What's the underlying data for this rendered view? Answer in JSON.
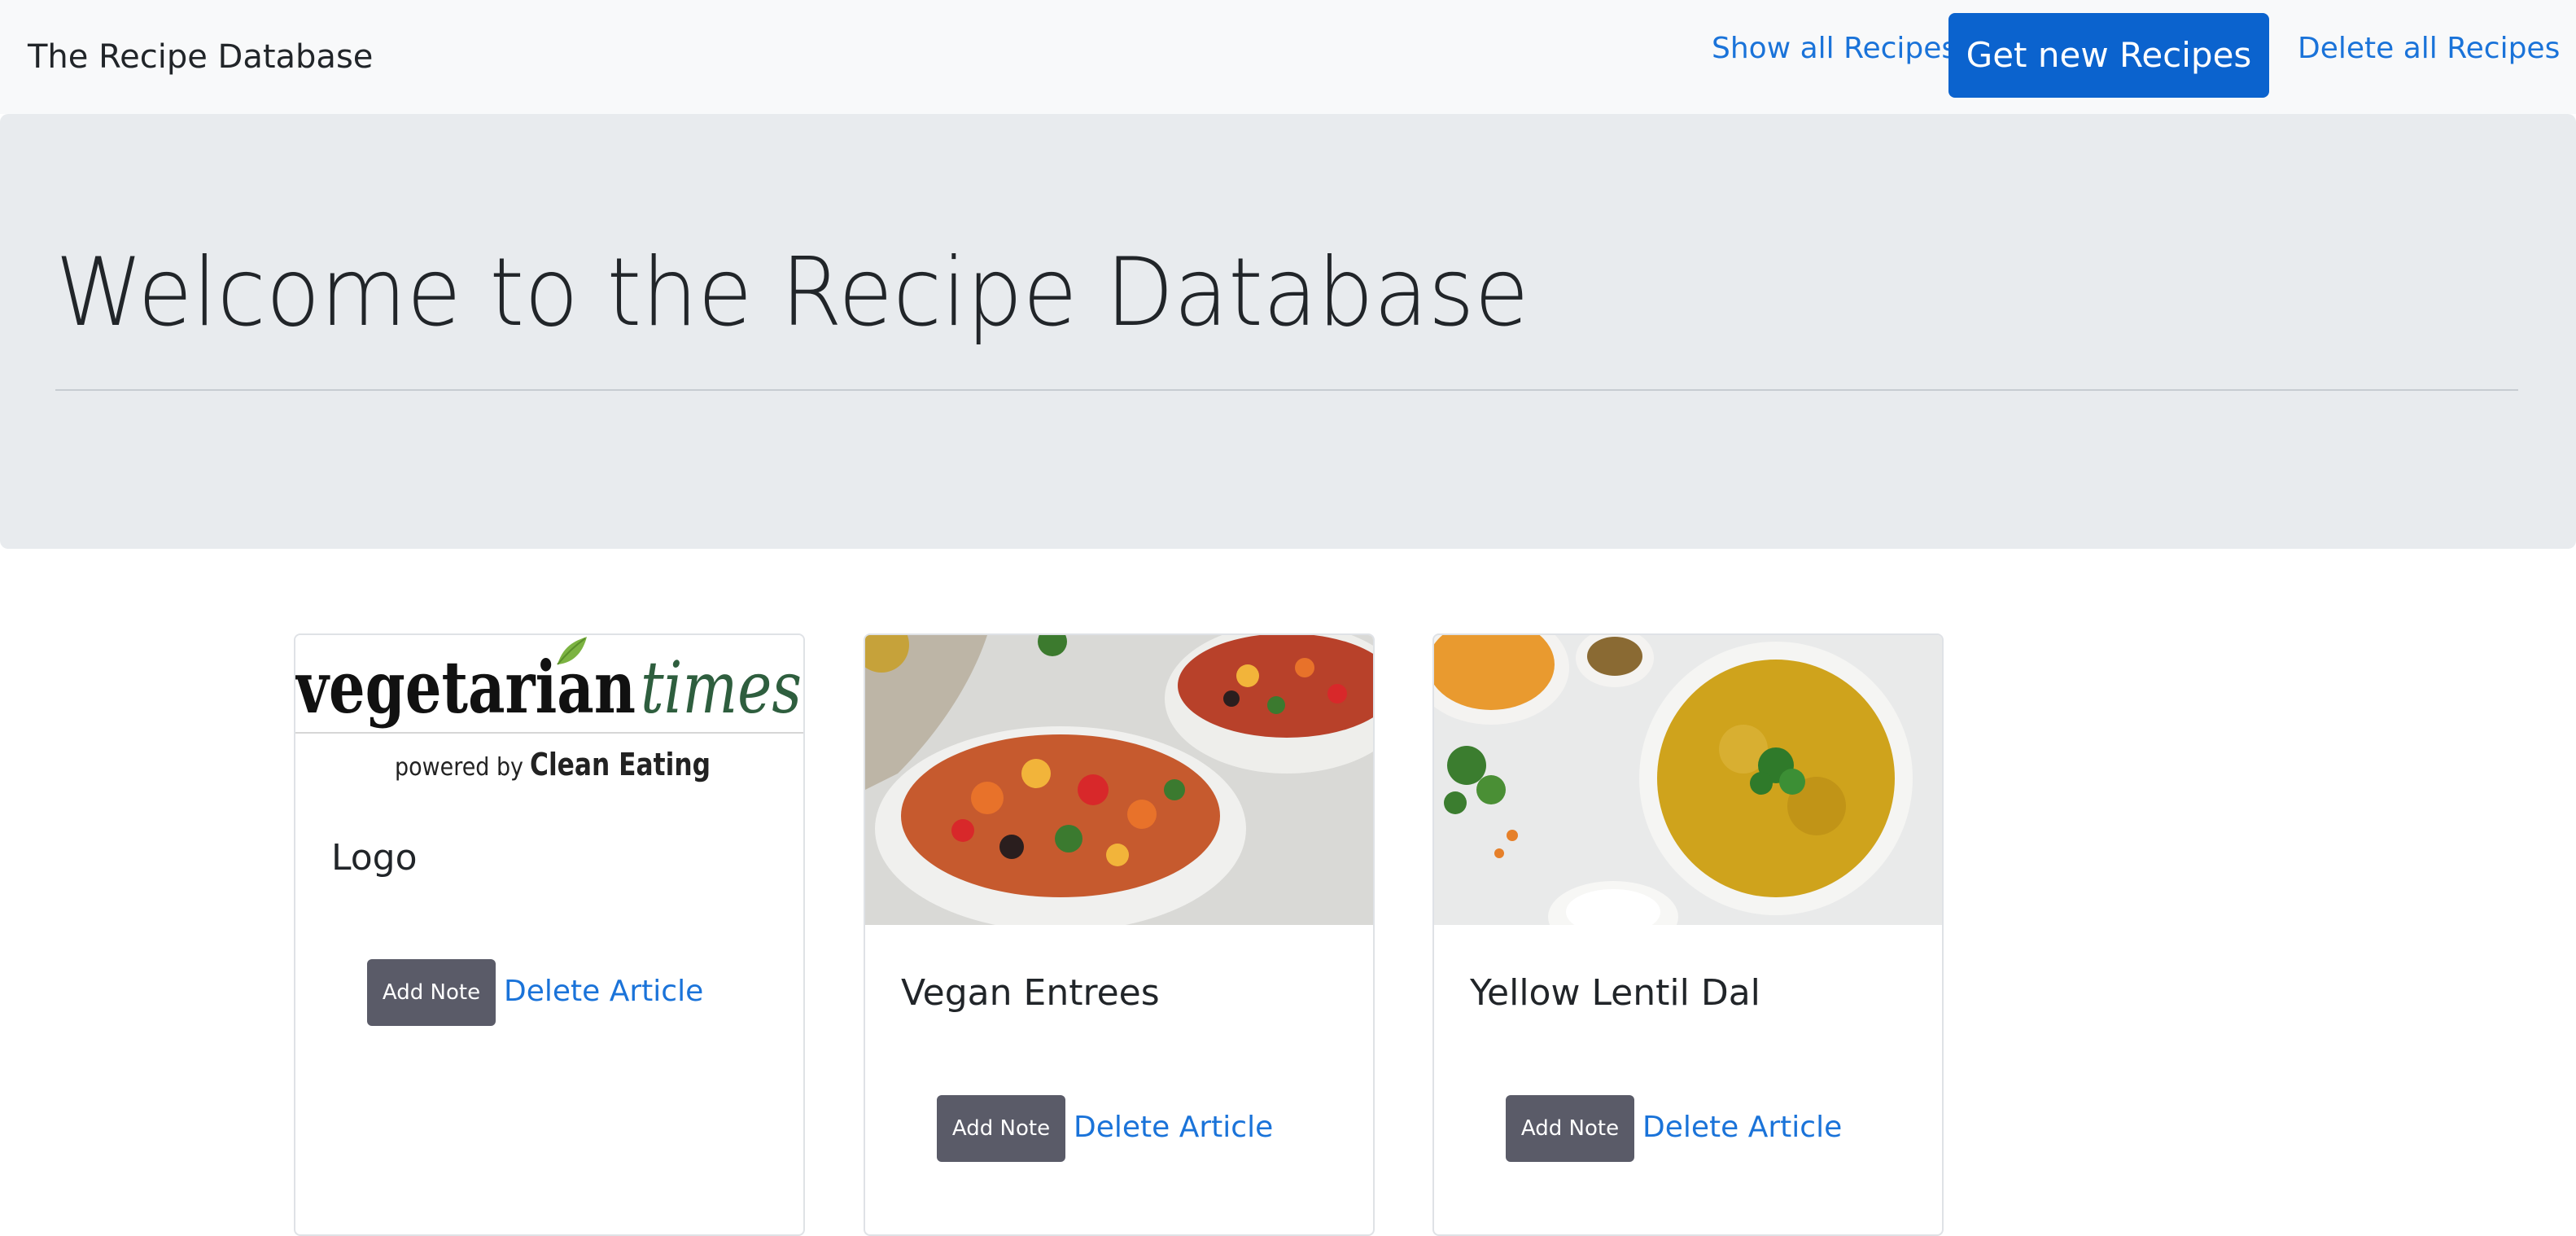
{
  "navbar": {
    "brand": "The Recipe Database",
    "show_all": "Show all Recipes",
    "get_new": "Get new Recipes",
    "delete_all": "Delete all Recipes"
  },
  "jumbotron": {
    "title": "Welcome to the Recipe Database"
  },
  "cards": [
    {
      "image_desc": "vegetariantimes-logo",
      "logo_text_main": "vegetarian",
      "logo_text_accent": "times",
      "logo_subtext_prefix": "powered by",
      "logo_subtext_brand": "Clean Eating",
      "title": "Logo",
      "note_label": "Add Note",
      "delete_label": "Delete Article"
    },
    {
      "image_desc": "vegan-bean-bowl-photo",
      "title": "Vegan Entrees",
      "note_label": "Add Note",
      "delete_label": "Delete Article"
    },
    {
      "image_desc": "yellow-lentil-dal-photo",
      "title": "Yellow Lentil Dal",
      "note_label": "Add Note",
      "delete_label": "Delete Article"
    }
  ],
  "colors": {
    "primary": "#0b63ce",
    "link": "#1a73d9",
    "navbar_bg": "#f8f9fa",
    "jumbotron_bg": "#e8ebee",
    "note_button": "#5a5b68",
    "logo_accent": "#2e5e3e"
  }
}
